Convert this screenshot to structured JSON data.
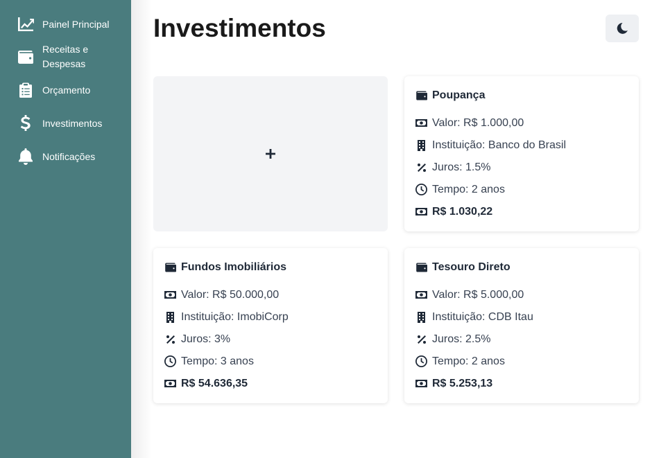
{
  "sidebar": {
    "items": [
      {
        "label": "Painel Principal",
        "icon": "chart-line-icon"
      },
      {
        "label": "Receitas e Despesas",
        "icon": "wallet-icon"
      },
      {
        "label": "Orçamento",
        "icon": "clipboard-list-icon"
      },
      {
        "label": "Investimentos",
        "icon": "dollar-sign-icon"
      },
      {
        "label": "Notificações",
        "icon": "bell-icon"
      }
    ]
  },
  "header": {
    "title": "Investimentos",
    "theme_toggle_icon": "moon-icon"
  },
  "add_card": {
    "icon": "plus-icon"
  },
  "investments": [
    {
      "name": "Poupança",
      "valor": "Valor: R$ 1.000,00",
      "instituicao": "Instituição: Banco do Brasil",
      "juros": "Juros: 1.5%",
      "tempo": "Tempo: 2 anos",
      "total": "R$ 1.030,22"
    },
    {
      "name": "Fundos Imobiliários",
      "valor": "Valor: R$ 50.000,00",
      "instituicao": "Instituição: ImobiCorp",
      "juros": "Juros: 3%",
      "tempo": "Tempo: 3 anos",
      "total": "R$ 54.636,35"
    },
    {
      "name": "Tesouro Direto",
      "valor": "Valor: R$ 5.000,00",
      "instituicao": "Instituição: CDB Itau",
      "juros": "Juros: 2.5%",
      "tempo": "Tempo: 2 anos",
      "total": "R$ 5.253,13"
    }
  ],
  "colors": {
    "sidebar_bg": "#4a7c7e",
    "add_card_bg": "#f3f4f6",
    "text_dark": "#1f2937"
  }
}
